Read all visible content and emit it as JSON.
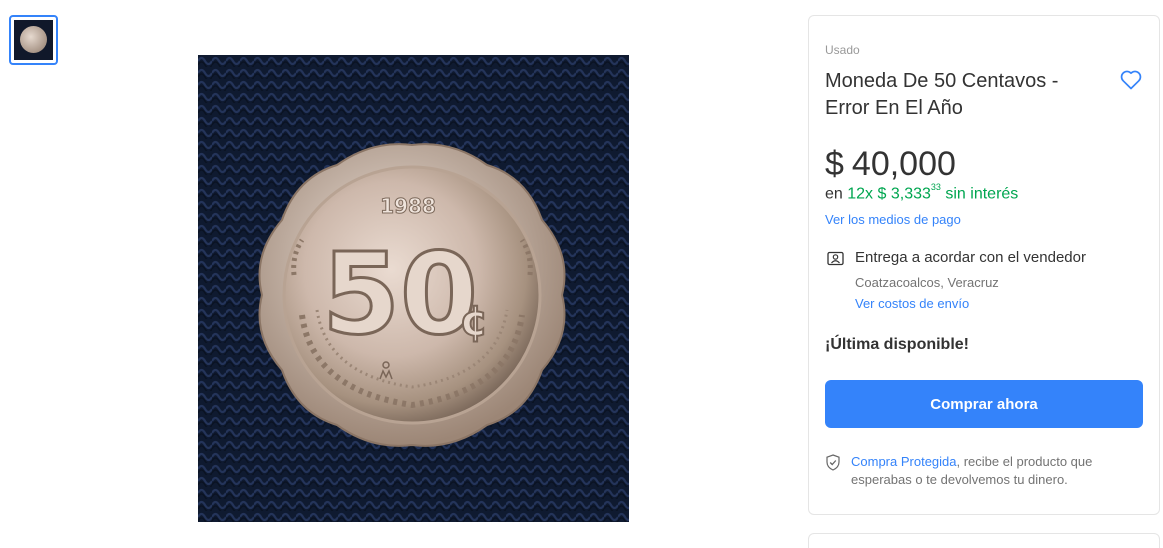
{
  "gallery": {
    "thumbnail_alt": "coin-thumbnail",
    "main_image_alt": "coin-photo",
    "coin_text": {
      "year": "1988",
      "denomination": "50",
      "currency_symbol": "¢"
    }
  },
  "product": {
    "condition": "Usado",
    "title": "Moneda De 50 Centavos - Error En El Año",
    "price": {
      "currency": "$",
      "amount": "40,000"
    },
    "installments": {
      "prefix": "en",
      "count": "12x",
      "currency": "$",
      "amount": "3,333",
      "cents": "33",
      "suffix": "sin interés"
    },
    "payment_methods_link": "Ver los medios de pago"
  },
  "delivery": {
    "text": "Entrega a acordar con el vendedor",
    "location": "Coatzacoalcos, Veracruz",
    "shipping_link": "Ver costos de envío"
  },
  "stock": {
    "text": "¡Última disponible!"
  },
  "actions": {
    "buy_now_label": "Comprar ahora"
  },
  "protection": {
    "link_text": "Compra Protegida",
    "rest_text": ", recibe el producto que esperabas o te devolvemos tu dinero."
  },
  "icons": {
    "favorite": "heart-icon",
    "delivery": "person-card-icon",
    "protection": "shield-check-icon"
  },
  "colors": {
    "accent": "#3483fa",
    "green": "#00a650",
    "text": "#333333",
    "muted": "#737373"
  }
}
